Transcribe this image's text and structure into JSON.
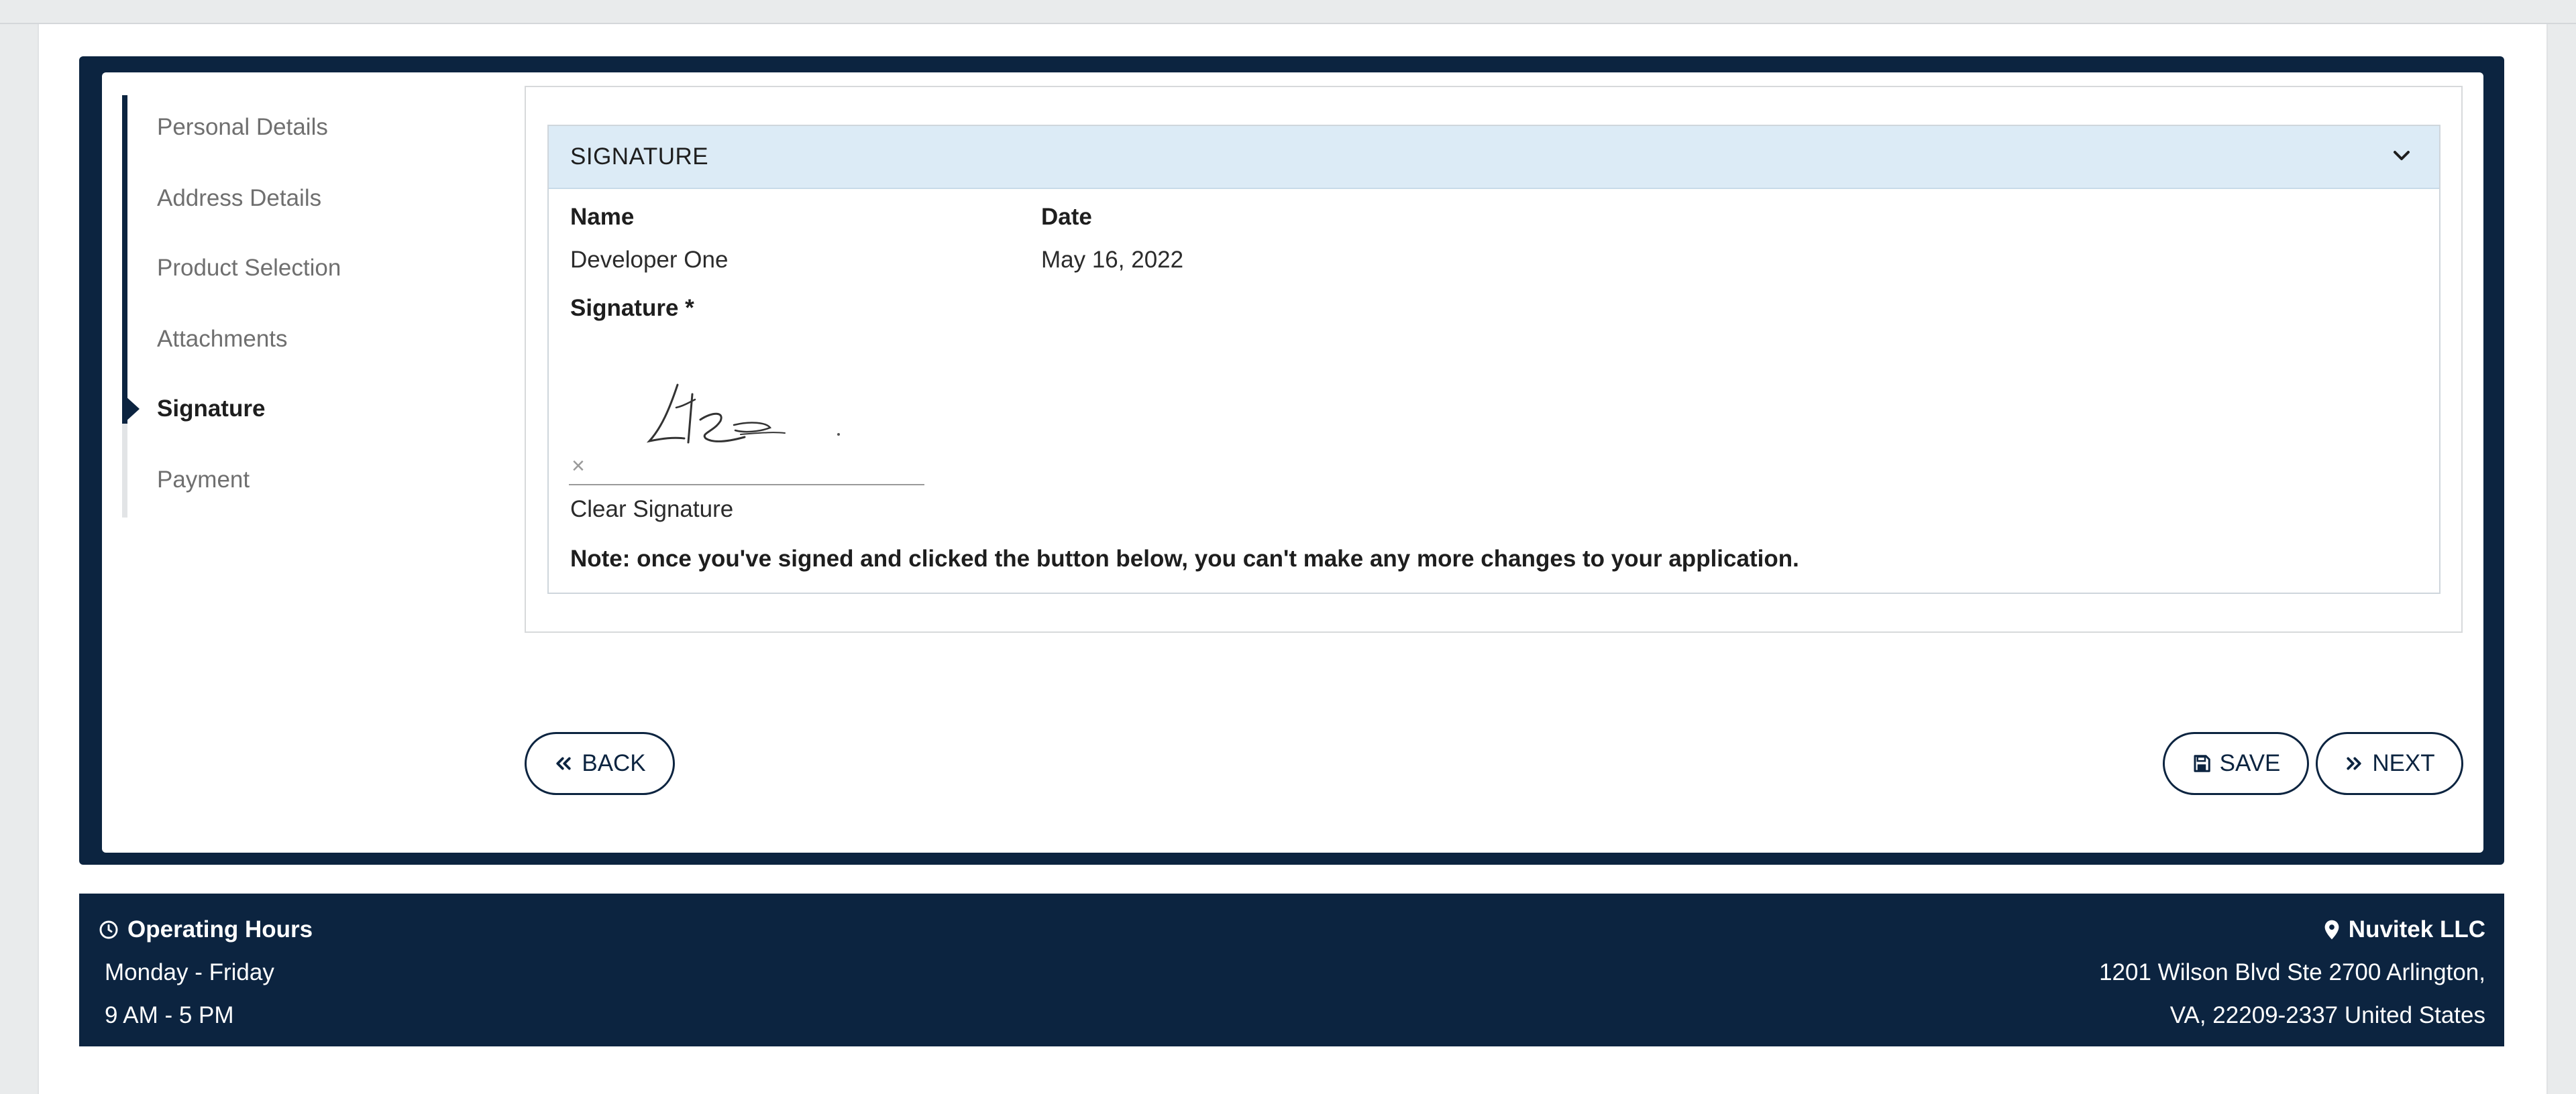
{
  "sidebar": {
    "items": [
      {
        "label": "Personal Details"
      },
      {
        "label": "Address Details"
      },
      {
        "label": "Product Selection"
      },
      {
        "label": "Attachments"
      },
      {
        "label": "Signature"
      },
      {
        "label": "Payment"
      }
    ]
  },
  "panel": {
    "title": "SIGNATURE",
    "name_label": "Name",
    "name_value": "Developer One",
    "date_label": "Date",
    "date_value": "May 16, 2022",
    "signature_label": "Signature *",
    "clear_mark": "×",
    "clear_label": "Clear Signature",
    "note": "Note: once you've signed and clicked the button below, you can't make any more changes to your application."
  },
  "buttons": {
    "back": "BACK",
    "save": "SAVE",
    "next": "NEXT"
  },
  "footer": {
    "hours_title": "Operating Hours",
    "hours_days": "Monday - Friday",
    "hours_time": "9 AM - 5 PM",
    "company": "Nuvitek LLC",
    "address_line1": "1201 Wilson Blvd Ste 2700 Arlington,",
    "address_line2": "VA, 22209-2337 United States"
  },
  "colors": {
    "navy": "#0c2440",
    "panel_header": "#dcebf6"
  },
  "icons": {
    "chevron": "chevron-down-icon",
    "back": "double-chevron-left-icon",
    "save": "floppy-disk-icon",
    "next": "double-chevron-right-icon",
    "clock": "clock-icon",
    "location": "map-pin-icon"
  }
}
